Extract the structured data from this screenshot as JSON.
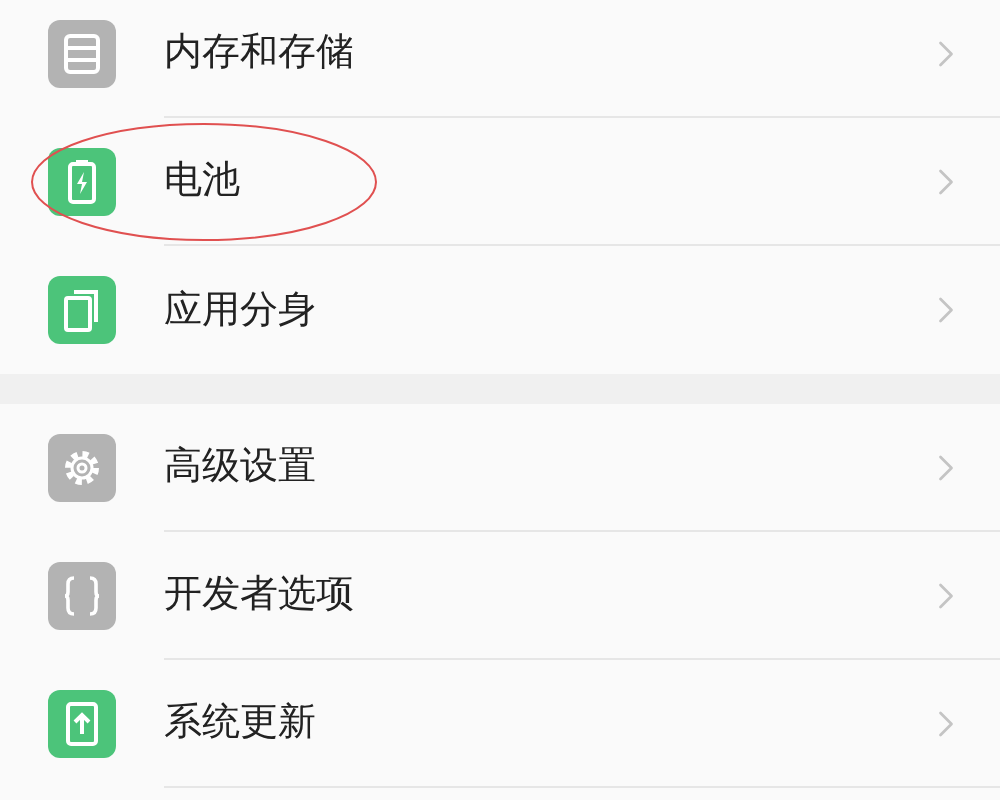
{
  "sections": [
    {
      "items": [
        {
          "label": "内存和存储",
          "kind": "storage",
          "highlighted": false
        },
        {
          "label": "电池",
          "kind": "battery",
          "highlighted": true
        },
        {
          "label": "应用分身",
          "kind": "clone",
          "highlighted": false
        }
      ]
    },
    {
      "items": [
        {
          "label": "高级设置",
          "kind": "gear",
          "highlighted": false
        },
        {
          "label": "开发者选项",
          "kind": "code",
          "highlighted": false
        },
        {
          "label": "系统更新",
          "kind": "update",
          "highlighted": false
        }
      ]
    }
  ]
}
